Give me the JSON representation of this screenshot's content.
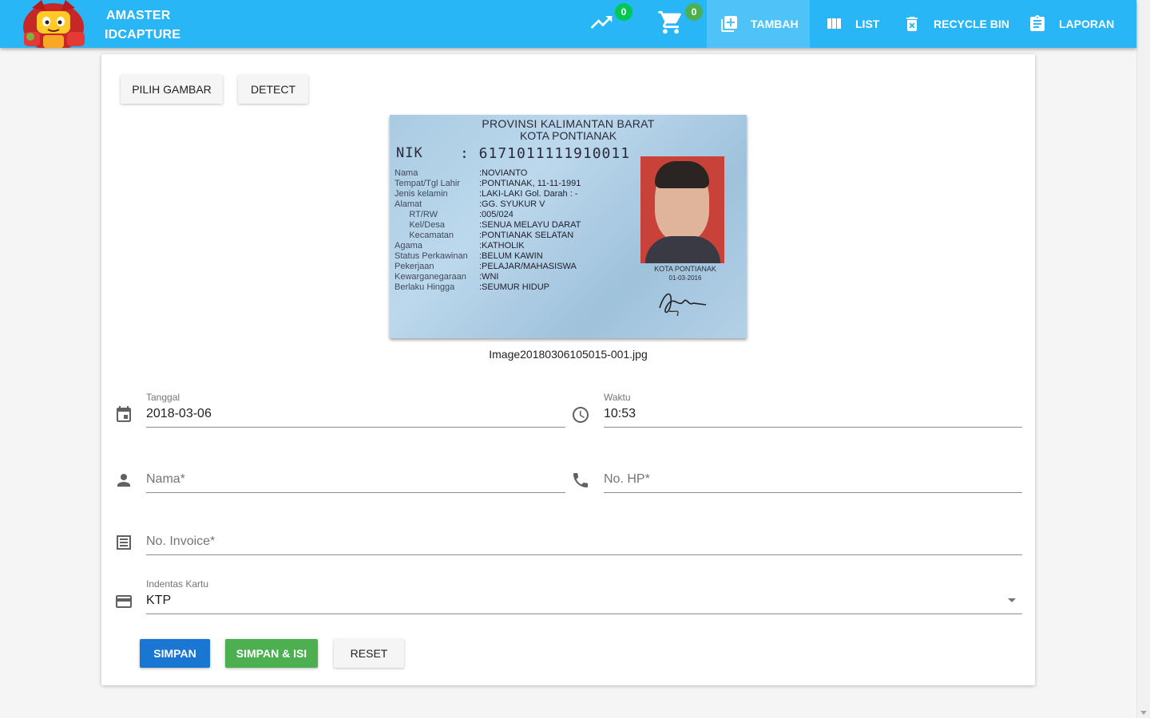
{
  "brand": {
    "line1": "AMASTER",
    "line2": "IDCAPTURE"
  },
  "header": {
    "trend_badge": "0",
    "cart_badge": "0",
    "nav": [
      {
        "label": "TAMBAH",
        "icon": "add-box-icon",
        "active": true
      },
      {
        "label": "LIST",
        "icon": "view-column-icon",
        "active": false
      },
      {
        "label": "RECYCLE BIN",
        "icon": "delete-icon",
        "active": false
      },
      {
        "label": "LAPORAN",
        "icon": "clipboard-icon",
        "active": false
      }
    ],
    "colors": {
      "appbar": "#29b6f6",
      "active": "#4fc3f7",
      "badge_trend": "#00c853",
      "badge_cart": "#4caf50"
    }
  },
  "toolbar": {
    "pick_image": "PILIH GAMBAR",
    "detect": "DETECT"
  },
  "image": {
    "filename": "Image20180306105015-001.jpg",
    "card": {
      "province": "PROVINSI KALIMANTAN BARAT",
      "city": "KOTA PONTIANAK",
      "nik_label": "NIK",
      "nik": ": 6171011111910011",
      "rows": [
        {
          "k": "Nama",
          "v": ":NOVIANTO"
        },
        {
          "k": "Tempat/Tgl Lahir",
          "v": ":PONTIANAK, 11-11-1991"
        },
        {
          "k": "Jenis kelamin",
          "v": ":LAKI-LAKI     Gol. Darah : -"
        },
        {
          "k": "Alamat",
          "v": ":GG. SYUKUR V"
        },
        {
          "k": "      RT/RW",
          "v": ":005/024"
        },
        {
          "k": "      Kel/Desa",
          "v": ":SENUA MELAYU DARAT"
        },
        {
          "k": "      Kecamatan",
          "v": ":PONTIANAK SELATAN"
        },
        {
          "k": "Agama",
          "v": ":KATHOLIK"
        },
        {
          "k": "Status Perkawinan",
          "v": ":BELUM KAWIN"
        },
        {
          "k": "Pekerjaan",
          "v": ":PELAJAR/MAHASISWA"
        },
        {
          "k": "Kewarganegaraan",
          "v": ":WNI"
        },
        {
          "k": "Berlaku Hingga",
          "v": ":SEUMUR HIDUP"
        }
      ],
      "issue_city": "KOTA PONTIANAK",
      "issue_date": "01-03-2016"
    }
  },
  "form": {
    "tanggal": {
      "label": "Tanggal",
      "value": "2018-03-06"
    },
    "waktu": {
      "label": "Waktu",
      "value": "10:53"
    },
    "nama": {
      "placeholder": "Nama*"
    },
    "hp": {
      "placeholder": "No. HP*"
    },
    "invoice": {
      "placeholder": "No. Invoice*"
    },
    "kartu": {
      "label": "Indentas Kartu",
      "value": "KTP"
    }
  },
  "actions": {
    "simpan": "SIMPAN",
    "simpan_isi": "SIMPAN & ISI",
    "reset": "RESET",
    "colors": {
      "simpan": "#1976d2",
      "simpan_isi": "#4caf50"
    }
  }
}
